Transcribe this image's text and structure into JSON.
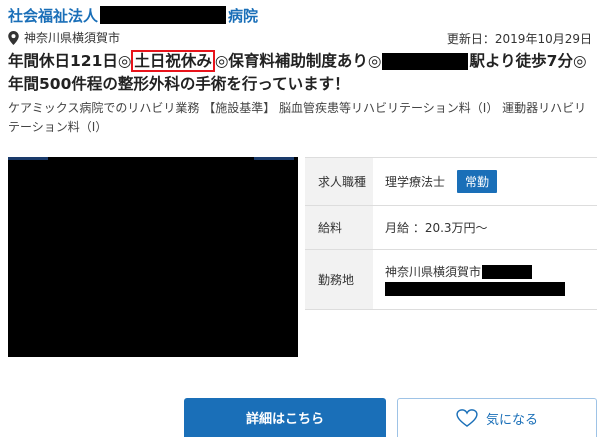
{
  "header": {
    "facility_prefix": "社会福祉法人",
    "facility_suffix": "病院",
    "location": "神奈川県横須賀市",
    "updated": "更新日：2019年10月29日"
  },
  "headline": {
    "part1": "年間休日121日◎",
    "highlight": "土日祝休み",
    "part2": "◎保育料補助制度あり◎",
    "part3": "駅より徒歩7分◎年間500件程の整形外科の手術を行っています！"
  },
  "description": "ケアミックス病院でのリハビリ業務 【施設基準】 脳血管疾患等リハビリテーション料（Ⅰ） 運動器リハビリテーション料（Ⅰ）",
  "job_info": {
    "type_label": "求人職種",
    "type_value": "理学療法士",
    "employment_badge": "常勤",
    "salary_label": "給料",
    "salary_value": "月給 ：20.3万円～",
    "location_label": "勤務地",
    "location_value": "神奈川県横須賀市"
  },
  "buttons": {
    "detail": "詳細はこちら",
    "favorite": "気になる"
  },
  "colors": {
    "link_blue": "#1a6fb8",
    "highlight_red": "#e8141c"
  }
}
